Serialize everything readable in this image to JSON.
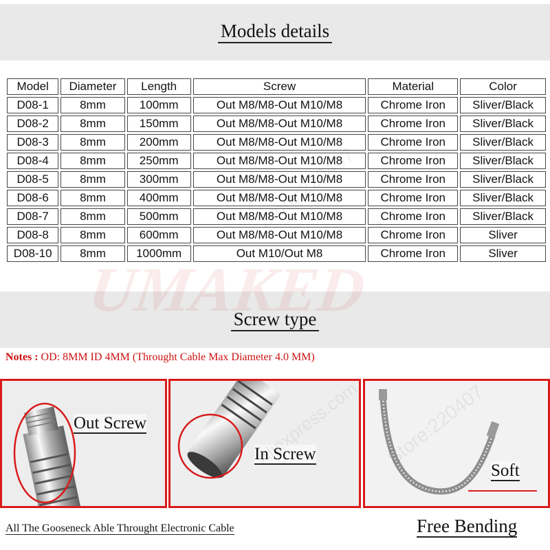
{
  "sections": {
    "models_title": "Models details",
    "screw_title": "Screw type"
  },
  "table": {
    "headers": [
      "Model",
      "Diameter",
      "Length",
      "Screw",
      "Material",
      "Color"
    ],
    "rows": [
      [
        "D08-1",
        "8mm",
        "100mm",
        "Out M8/M8-Out M10/M8",
        "Chrome Iron",
        "Sliver/Black"
      ],
      [
        "D08-2",
        "8mm",
        "150mm",
        "Out M8/M8-Out M10/M8",
        "Chrome Iron",
        "Sliver/Black"
      ],
      [
        "D08-3",
        "8mm",
        "200mm",
        "Out M8/M8-Out M10/M8",
        "Chrome Iron",
        "Sliver/Black"
      ],
      [
        "D08-4",
        "8mm",
        "250mm",
        "Out M8/M8-Out M10/M8",
        "Chrome Iron",
        "Sliver/Black"
      ],
      [
        "D08-5",
        "8mm",
        "300mm",
        "Out M8/M8-Out M10/M8",
        "Chrome Iron",
        "Sliver/Black"
      ],
      [
        "D08-6",
        "8mm",
        "400mm",
        "Out M8/M8-Out M10/M8",
        "Chrome Iron",
        "Sliver/Black"
      ],
      [
        "D08-7",
        "8mm",
        "500mm",
        "Out M8/M8-Out M10/M8",
        "Chrome Iron",
        "Sliver/Black"
      ],
      [
        "D08-8",
        "8mm",
        "600mm",
        "Out M8/M8-Out M10/M8",
        "Chrome Iron",
        "Sliver"
      ],
      [
        "D08-10",
        "8mm",
        "1000mm",
        "Out M10/Out M8",
        "Chrome Iron",
        "Sliver"
      ]
    ]
  },
  "notes": {
    "label": "Notes :",
    "text": "OD: 8MM ID 4MM (Throught Cable Max Diameter  4.0 MM)"
  },
  "photos": {
    "out_screw": "Out Screw",
    "in_screw": "In Screw",
    "soft": "Soft"
  },
  "footer": {
    "left": "All The Gooseneck Able Throught Electronic Cable",
    "right": "Free Bending"
  },
  "watermark": {
    "brand": "UMAKED",
    "store": "Store:220407",
    "site": "Aliexpress.com"
  },
  "colors": {
    "accent_red": "#d91a1a",
    "notes_red": "#cc1111",
    "band_gray": "#e9e9e9"
  }
}
